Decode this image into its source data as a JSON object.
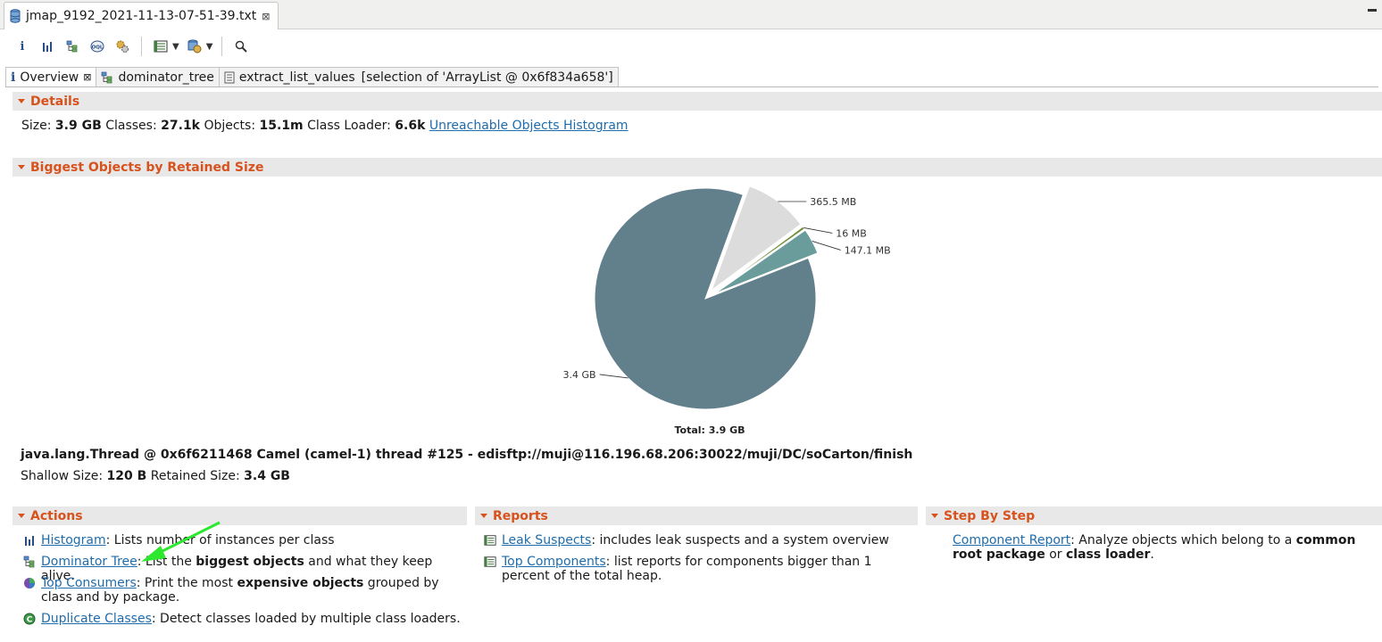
{
  "editor": {
    "tab_title": "jmap_9192_2021-11-13-07-51-39.txt",
    "close": "⊠"
  },
  "inner_tabs": [
    {
      "label": "Overview",
      "icon": "info-icon",
      "close": "⊠"
    },
    {
      "label": "dominator_tree",
      "icon": "dominator-tree-icon"
    },
    {
      "label": "extract_list_values",
      "icon": "list-icon",
      "suffix": "[selection of 'ArrayList @ 0x6f834a658']"
    }
  ],
  "details": {
    "header": "Details",
    "size_label": "Size:",
    "size_value": "3.9 GB",
    "classes_label": "Classes:",
    "classes_value": "27.1k",
    "objects_label": "Objects:",
    "objects_value": "15.1m",
    "loader_label": "Class Loader:",
    "loader_value": "6.6k",
    "unreachable_link": "Unreachable Objects Histogram"
  },
  "biggest": {
    "header": "Biggest Objects by Retained Size",
    "object_title": "java.lang.Thread @ 0x6f6211468 Camel (camel-1) thread #125 - edisftp://muji@116.196.68.206:30022/muji/DC/soCarton/finish",
    "shallow_label": "Shallow Size:",
    "shallow_value": "120 B",
    "retained_label": "Retained Size:",
    "retained_value": "3.4 GB"
  },
  "chart_data": {
    "type": "pie",
    "total_label": "Total: 3.9 GB",
    "slices": [
      {
        "label": "3.4 GB",
        "value": 3400,
        "color": "#627f8c"
      },
      {
        "label": "365.5 MB",
        "value": 365.5,
        "color": "#dcdcdc"
      },
      {
        "label": "16 MB",
        "value": 16,
        "color": "#6f8f3a"
      },
      {
        "label": "147.1 MB",
        "value": 147.1,
        "color": "#6a9c9c"
      }
    ]
  },
  "actions": {
    "header": "Actions",
    "items": [
      {
        "link": "Histogram",
        "pre": ": Lists number of instances per class",
        "bold": "",
        "post": ""
      },
      {
        "link": "Dominator Tree",
        "pre": ": List the ",
        "bold": "biggest objects",
        "post": " and what they keep alive."
      },
      {
        "link": "Top Consumers",
        "pre": ": Print the most ",
        "bold": "expensive objects",
        "post": " grouped by class and by package."
      },
      {
        "link": "Duplicate Classes",
        "pre": ": Detect classes loaded by multiple class loaders.",
        "bold": "",
        "post": ""
      }
    ]
  },
  "reports": {
    "header": "Reports",
    "items": [
      {
        "link": "Leak Suspects",
        "text": ": includes leak suspects and a system overview"
      },
      {
        "link": "Top Components",
        "text": ": list reports for components bigger than 1 percent of the total heap."
      }
    ]
  },
  "steps": {
    "header": "Step By Step",
    "link": "Component Report",
    "pre": ": Analyze objects which belong to a ",
    "bold1": "common root package",
    "mid": " or ",
    "bold2": "class loader",
    "post": "."
  }
}
